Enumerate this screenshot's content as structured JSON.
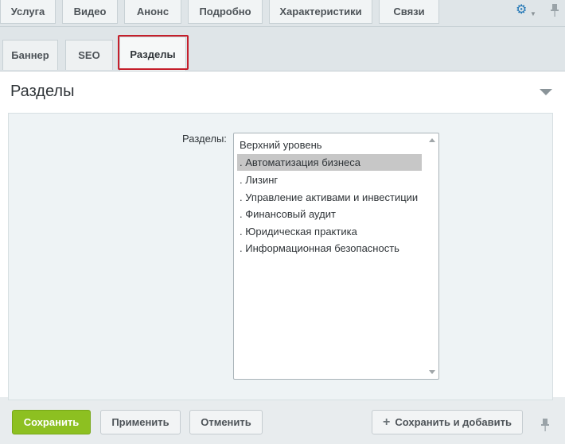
{
  "top_tabs": [
    "Услуга",
    "Видео",
    "Анонс",
    "Подробно",
    "Характеристики",
    "Связи"
  ],
  "sub_tabs": [
    "Баннер",
    "SEO",
    "Разделы"
  ],
  "active_sub_tab": "Разделы",
  "section": {
    "title": "Разделы",
    "field_label": "Разделы:",
    "list_items": [
      "Верхний уровень",
      ". Автоматизация бизнеса",
      ". Лизинг",
      ". Управление активами и инвестиции",
      ". Финансовый аудит",
      ". Юридическая практика",
      ". Информационная безопасность"
    ],
    "selected_item": ". Автоматизация бизнеса"
  },
  "buttons": {
    "save": "Сохранить",
    "apply": "Применить",
    "cancel": "Отменить",
    "save_and_add": "Сохранить и добавить"
  },
  "colors": {
    "accent_green": "#8dc021",
    "highlight_red": "#c51f2b",
    "gear_blue": "#2176b5"
  }
}
